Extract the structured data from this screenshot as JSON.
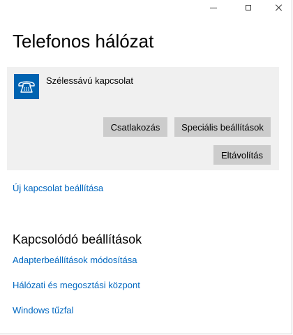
{
  "window": {
    "controls": {
      "minimize_icon": "minimize-icon",
      "maximize_icon": "maximize-icon",
      "close_icon": "close-icon"
    }
  },
  "page": {
    "title": "Telefonos hálózat"
  },
  "connection": {
    "icon": "dialup-phone-icon",
    "name": "Szélessávú kapcsolat",
    "buttons": {
      "connect": "Csatlakozás",
      "advanced": "Speciális beállítások",
      "remove": "Eltávolítás"
    }
  },
  "links": {
    "new_connection": "Új kapcsolat beállítása"
  },
  "related": {
    "title": "Kapcsolódó beállítások",
    "items": [
      "Adapterbeállítások módosítása",
      "Hálózati és megosztási központ",
      "Windows tűzfal"
    ]
  },
  "colors": {
    "accent": "#0063b1",
    "link": "#0067c0",
    "panel_bg": "#f0f0f0",
    "button_bg": "#cccccc"
  }
}
